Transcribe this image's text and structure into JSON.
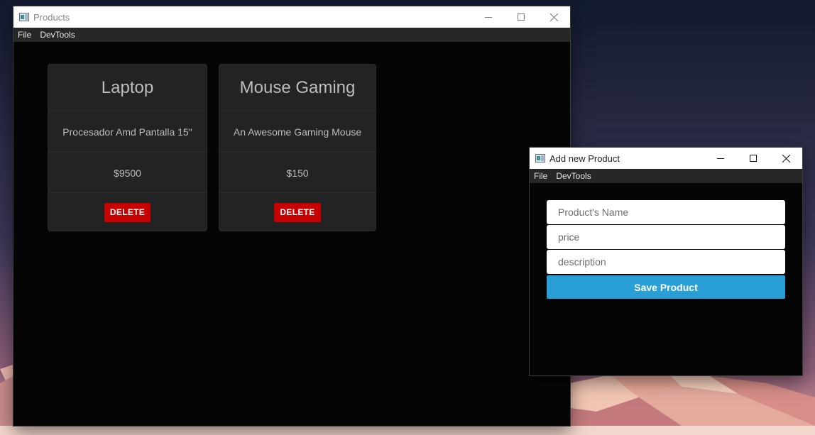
{
  "products_window": {
    "title": "Products",
    "menu": [
      "File",
      "DevTools"
    ],
    "cards": [
      {
        "name": "Laptop",
        "description": "Procesador Amd Pantalla 15\"",
        "price": "$9500",
        "delete_label": "DELETE"
      },
      {
        "name": "Mouse Gaming",
        "description": "An Awesome Gaming Mouse",
        "price": "$150",
        "delete_label": "DELETE"
      }
    ]
  },
  "add_window": {
    "title": "Add new Product",
    "menu": [
      "File",
      "DevTools"
    ],
    "form": {
      "name_placeholder": "Product's Name",
      "price_placeholder": "price",
      "description_placeholder": "description",
      "save_label": "Save Product"
    }
  },
  "colors": {
    "delete_button": "#c70000",
    "save_button": "#2a9fd6",
    "card_background": "#232323",
    "window_background": "#050505"
  }
}
